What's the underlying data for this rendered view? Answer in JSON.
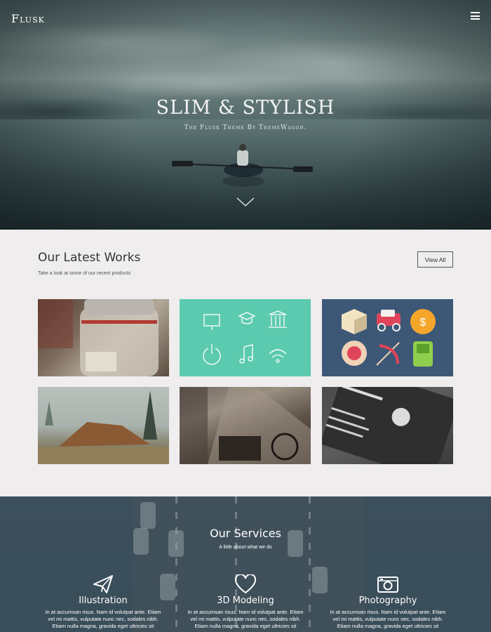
{
  "header": {
    "logo": "Flusk"
  },
  "hero": {
    "title": "SLIM & STYLISH",
    "subtitle": "The Flusk Theme By ThemeWagon."
  },
  "works": {
    "title": "Our Latest Works",
    "subtitle": "Take a look at some of our recent products",
    "view_all_label": "View All"
  },
  "services": {
    "title": "Our Services",
    "subtitle": "A little about what we do",
    "items": [
      {
        "icon": "paper-plane-icon",
        "title": "Illustration",
        "text": "In at accumsan risus. Nam id volutpat ante. Etiam vel mi mattis, vulputate nunc nec, sodales nibh. Etiam nulla magna, gravida eget ultricies sit"
      },
      {
        "icon": "heart-icon",
        "title": "3D Modeling",
        "text": "In at accumsan risus. Nam id volutpat ante. Etiam vel mi mattis, vulputate nunc nec, sodales nibh. Etiam nulla magna, gravida eget ultricies sit"
      },
      {
        "icon": "camera-icon",
        "title": "Photography",
        "text": "In at accumsan risus. Nam id volutpat ante. Etiam vel mi mattis, vulputate nunc nec, sodales nibh. Etiam nulla magna, gravida eget ultricies sit"
      }
    ]
  },
  "colors": {
    "page_bg": "#efedee",
    "tile_teal": "#5ccaae",
    "tile_navy": "#3d5877",
    "services_bg": "#3c4f5c"
  }
}
